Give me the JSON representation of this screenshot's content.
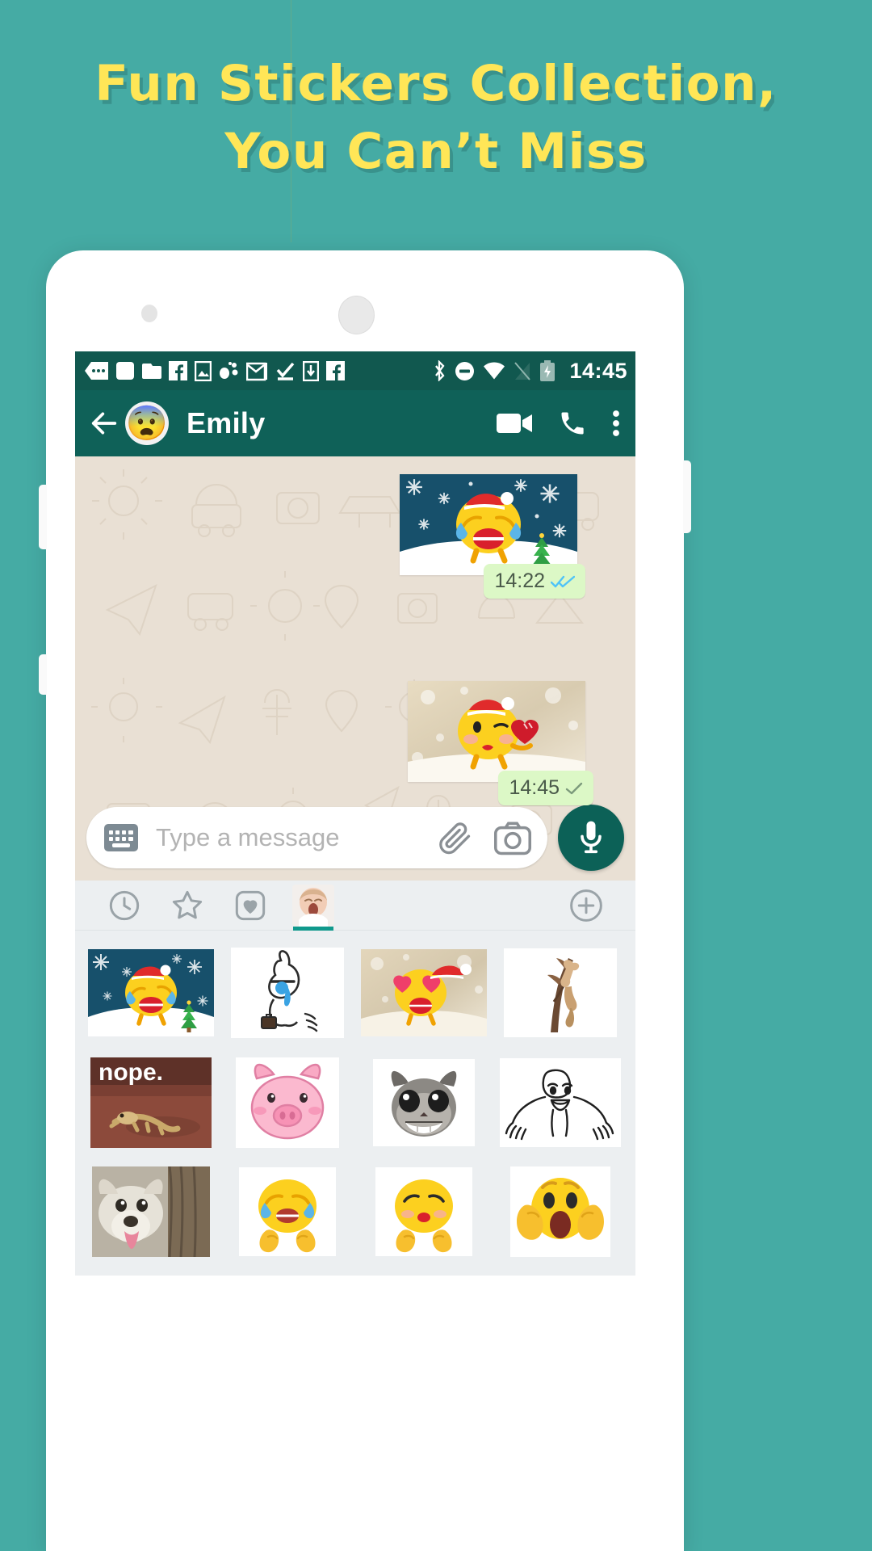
{
  "promo": {
    "line1": "Fun Stickers Collection,",
    "line2": "You Can’t Miss",
    "text_color": "#ffe657",
    "background_color": "#45aba4"
  },
  "statusbar": {
    "time": "14:45",
    "background_color": "#11584f",
    "left_icons": [
      "sms-message-icon",
      "app-notification-icon",
      "folder-notification-icon",
      "facebook-icon",
      "gallery-image-icon",
      "music-note-icon",
      "gmail-icon",
      "task-check-icon",
      "download-icon",
      "facebook-messenger-icon"
    ],
    "right_icons": [
      "bluetooth-icon",
      "do-not-disturb-icon",
      "wifi-icon",
      "signal-off-icon",
      "battery-charging-icon"
    ]
  },
  "appbar": {
    "back_label": "Back",
    "contact_name": "Emily",
    "avatar_emoji": "😨",
    "background_color": "#0f6158",
    "actions": [
      {
        "name": "video-call-button",
        "label": "Video call"
      },
      {
        "name": "voice-call-button",
        "label": "Voice call"
      },
      {
        "name": "overflow-menu-button",
        "label": "More options"
      }
    ]
  },
  "chat": {
    "wallpaper_color": "#e9e0d4",
    "bubble_color": "#dcf8c6",
    "messages": [
      {
        "id": "message-1",
        "sticker": "laughing-tears-santa-snow-sticker",
        "time": "14:22",
        "status": "read",
        "ticks": 2
      },
      {
        "id": "message-2",
        "sticker": "kissing-heart-santa-sparkle-sticker",
        "time": "14:45",
        "status": "sent",
        "ticks": 1
      }
    ]
  },
  "input": {
    "placeholder": "Type a message",
    "keyboard_icon": "keyboard-icon",
    "attach_icon": "paperclip-icon",
    "camera_icon": "camera-icon",
    "mic_icon": "microphone-icon",
    "mic_color": "#0c6157"
  },
  "sticker_tabs": {
    "accent_color": "#10998c",
    "items": [
      {
        "name": "tab-recent",
        "icon": "clock-icon",
        "active": false
      },
      {
        "name": "tab-favorites",
        "icon": "star-icon",
        "active": false
      },
      {
        "name": "tab-hearts",
        "icon": "heart-icon",
        "active": false
      },
      {
        "name": "tab-baby-pack",
        "icon": "yawning-baby-thumbnail",
        "active": true
      }
    ],
    "add_button": {
      "name": "add-sticker-pack-button",
      "icon": "plus-circle-icon"
    }
  },
  "sticker_grid": {
    "background_color": "#eceff1",
    "stickers": [
      {
        "name": "sticker-laughing-tears-santa",
        "label": "Laughing tears emoji with santa hat on snow"
      },
      {
        "name": "sticker-crying-bunny-briefcase",
        "label": "White crying bunny with briefcase"
      },
      {
        "name": "sticker-heart-eyes-santa",
        "label": "Heart eyes emoji with santa hat"
      },
      {
        "name": "sticker-climbing-cat-tree",
        "label": "Cat climbing a tree branch"
      },
      {
        "name": "sticker-nope-lizard",
        "label": "nope. lizard meme",
        "caption": "nope."
      },
      {
        "name": "sticker-pink-pig",
        "label": "Pink cartoon pig face"
      },
      {
        "name": "sticker-grinning-cat",
        "label": "Grinning cat with big eyes"
      },
      {
        "name": "sticker-shrug-rage-face",
        "label": "Rage comic shrug face line drawing"
      },
      {
        "name": "sticker-dog-tongue-tree",
        "label": "Dog with tongue out behind tree"
      },
      {
        "name": "sticker-crying-laughing-hands",
        "label": "Crying laughing emoji with hands"
      },
      {
        "name": "sticker-kissing-emoji-hands",
        "label": "Kissing emoji covering mouth"
      },
      {
        "name": "sticker-screaming-face",
        "label": "Screaming face emoji hands on cheeks"
      }
    ]
  }
}
